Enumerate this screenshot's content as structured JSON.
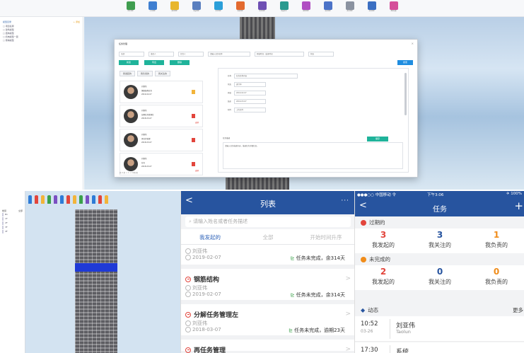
{
  "top_panel": {
    "toolbar_items": [
      {
        "icon": "green-doc-icon",
        "color": "#3f9d4f",
        "label": "构件管理"
      },
      {
        "icon": "blue-person-icon",
        "color": "#3f7fd1",
        "label": "人员管理"
      },
      {
        "icon": "yellow-folder-icon",
        "color": "#e8b62c",
        "label": "资料管理"
      },
      {
        "icon": "blue-box-icon",
        "color": "#5a7fbf",
        "label": "质量管理"
      },
      {
        "icon": "gear-icon",
        "color": "#2b9fd9",
        "label": "安全管理"
      },
      {
        "icon": "colorful-grid-icon",
        "color": "#e36a2f",
        "label": "进度管理"
      },
      {
        "icon": "purple-chart-icon",
        "color": "#6e4fb3",
        "label": "任务管理"
      },
      {
        "icon": "teal-list-icon",
        "color": "#2a9a8f",
        "label": "质量安全"
      },
      {
        "icon": "purple-star-icon",
        "color": "#b04fc2",
        "label": "模型管理"
      },
      {
        "icon": "blue-table-icon",
        "color": "#4b73c8",
        "label": "成本管理"
      },
      {
        "icon": "gray-layers-icon",
        "color": "#8a92a0",
        "label": "视点管理"
      },
      {
        "icon": "blue-doc-icon",
        "color": "#3b6fc2",
        "label": "文档管理"
      },
      {
        "icon": "pink-heart-icon",
        "color": "#d54f9a",
        "label": "系统设置"
      }
    ],
    "tree": {
      "head_left": "模型目录",
      "head_right": "+ 添加",
      "rows": [
        "□ 项目名称",
        "  □ 建筑模型",
        "  □ 结构模型",
        "  □ 机电模型一层",
        "  □ 幕墙模型"
      ]
    },
    "dialog": {
      "title": "任务管理",
      "filters": [
        "全部",
        "发起人",
        "负责人",
        "请输入任务名称",
        "开始时间 - 结束时间",
        "状态"
      ],
      "buttons": [
        "新建",
        "导出",
        "删除"
      ],
      "right_button": "搜索",
      "tabs": [
        "我发起的",
        "我负责的",
        "我关注的"
      ],
      "cards": [
        {
          "name": "刘亚伟",
          "line2": "钢筋结构任务",
          "line3": "2019-02-07",
          "flag_color": "#f2b43a",
          "right_text": ""
        },
        {
          "name": "刘亚伟",
          "line2": "分解任务管理左",
          "line3": "2018-03-07",
          "flag_color": "#e2453c",
          "right_text": "逾期"
        },
        {
          "name": "刘亚伟",
          "line2": "再任务管理",
          "line3": "2018-03-07",
          "flag_color": "#e2453c",
          "right_text": ""
        },
        {
          "name": "刘亚伟",
          "line2": "任务",
          "line3": "2018-03-07",
          "flag_color": "#e2453c",
          "right_text": "逾期"
        }
      ],
      "detail_fields": [
        {
          "label": "名称",
          "value": "任务名称内容"
        },
        {
          "label": "状态",
          "value": "进行中"
        },
        {
          "label": "开始",
          "value": "2019-02-07"
        },
        {
          "label": "结束",
          "value": "2019-03-07"
        },
        {
          "label": "附件",
          "value": "上传文件"
        }
      ],
      "detail_button": "保存",
      "desc_label": "任务描述",
      "desc_text": "请输入任务描述内容，描述任务详细信息。",
      "pager": "共 4 条  < 1 >  10条/页"
    }
  },
  "bottom_left": {
    "side_labels": [
      "楼层",
      "全部"
    ],
    "side_rows": [
      "B1",
      "1F",
      "2F",
      "3F",
      "4F"
    ],
    "pins": [
      "#2e7bd6",
      "#e2453c",
      "#f2b43a",
      "#3aa04a",
      "#7a4fc2",
      "#2e7bd6",
      "#e2453c",
      "#f2b43a",
      "#3aa04a",
      "#7a4fc2",
      "#2e7bd6",
      "#e2453c",
      "#f2b43a"
    ]
  },
  "list_screen": {
    "title": "列表",
    "back": "<",
    "more": "···",
    "search_placeholder": "请输入姓名或者任务描述",
    "tabs": [
      "我发起的",
      "全部",
      "开始时间升序"
    ],
    "items": [
      {
        "title": "",
        "person": "刘亚伟",
        "date": "2019-02-07",
        "status": "任务未完成，余314天"
      },
      {
        "title": "钢筋结构",
        "person": "刘亚伟",
        "date": "2019-02-07",
        "status": "任务未完成，余314天"
      },
      {
        "title": "分解任务管理左",
        "person": "刘亚伟",
        "date": "2018-03-07",
        "status": "任务未完成，逾期23天"
      },
      {
        "title": "再任务管理",
        "person": "",
        "date": "",
        "status": ""
      }
    ]
  },
  "task_screen": {
    "status_bar": {
      "carrier": "●●●○○ 中国移动 令",
      "time": "下午3:06",
      "battery": "✈ 100%"
    },
    "title": "任务",
    "back": "<",
    "plus": "+",
    "overdue": {
      "label": "过期的",
      "color": "#e2453c",
      "stats": [
        {
          "value": "3",
          "label": "我发起的",
          "color": "#e2453c"
        },
        {
          "value": "3",
          "label": "我关注的",
          "color": "#27549f"
        },
        {
          "value": "1",
          "label": "我负责的",
          "color": "#f08c1a"
        }
      ]
    },
    "incomplete": {
      "label": "未完成的",
      "color": "#f08c1a",
      "stats": [
        {
          "value": "2",
          "label": "我发起的",
          "color": "#e2453c"
        },
        {
          "value": "0",
          "label": "我关注的",
          "color": "#27549f"
        },
        {
          "value": "0",
          "label": "我负责的",
          "color": "#f08c1a"
        }
      ]
    },
    "feed_header": {
      "label": "动态",
      "more": "更多"
    },
    "feed": [
      {
        "time": "10:52",
        "date": "03-26",
        "name": "刘亚伟",
        "sub": "Taolun"
      },
      {
        "time": "17:30",
        "date": "",
        "name": "系统",
        "sub": ""
      }
    ]
  }
}
